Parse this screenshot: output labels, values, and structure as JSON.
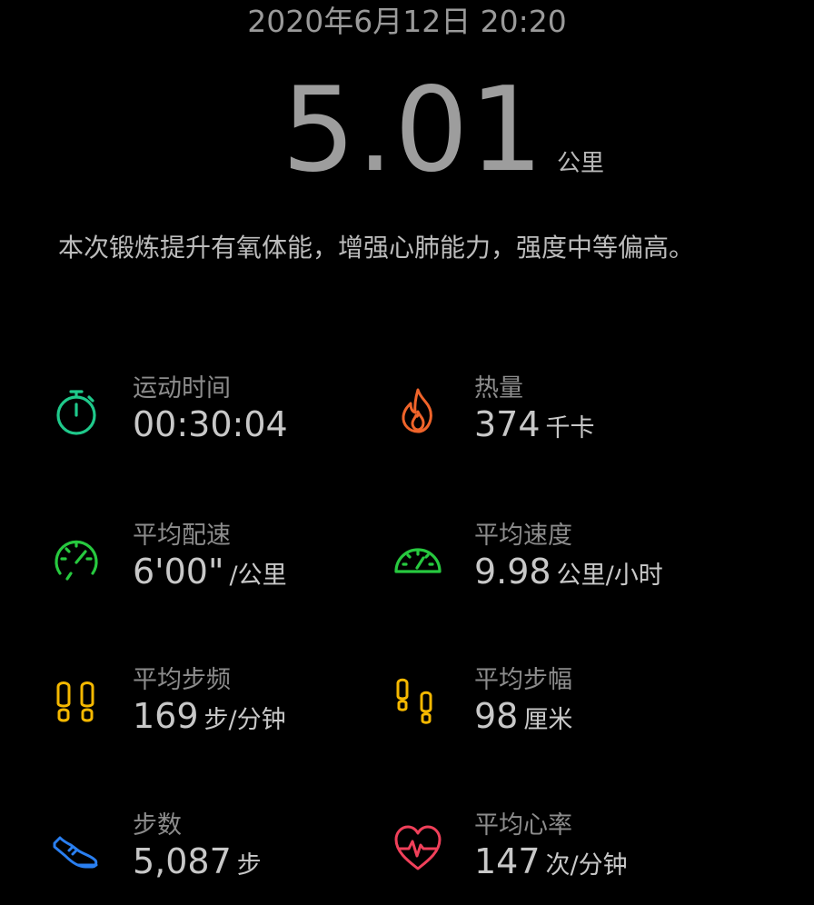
{
  "header": {
    "datetime": "2020年6月12日 20:20"
  },
  "distance": {
    "value": "5.01",
    "unit": "公里"
  },
  "summary": "本次锻炼提升有氧体能，增强心肺能力，强度中等偏高。",
  "metrics": [
    {
      "icon": "stopwatch-icon",
      "color": "#1fc98b",
      "label": "运动时间",
      "value": "00:30:04",
      "unit": ""
    },
    {
      "icon": "flame-icon",
      "color": "#f0642a",
      "label": "热量",
      "value": "374",
      "unit": "千卡"
    },
    {
      "icon": "pace-gauge-icon",
      "color": "#27c93f",
      "label": "平均配速",
      "value": "6'00\"",
      "unit": "/公里"
    },
    {
      "icon": "speedometer-icon",
      "color": "#27c93f",
      "label": "平均速度",
      "value": "9.98",
      "unit": "公里/小时"
    },
    {
      "icon": "footprints-icon",
      "color": "#f5b800",
      "label": "平均步频",
      "value": "169",
      "unit": "步/分钟"
    },
    {
      "icon": "stride-footprints-icon",
      "color": "#f5b800",
      "label": "平均步幅",
      "value": "98",
      "unit": "厘米"
    },
    {
      "icon": "shoe-icon",
      "color": "#2a7ff0",
      "label": "步数",
      "value": "5,087",
      "unit": "步"
    },
    {
      "icon": "heart-rate-icon",
      "color": "#f0405a",
      "label": "平均心率",
      "value": "147",
      "unit": "次/分钟"
    }
  ]
}
